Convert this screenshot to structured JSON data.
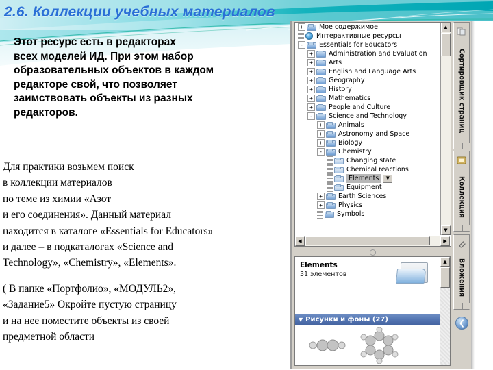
{
  "slide": {
    "title": "2.6. Коллекции учебных материалов",
    "accent_color": "#2a6fd6",
    "header_color": "#00b0b9",
    "paragraph_1": [
      "Этот ресурс есть в редакторах",
      "всех моделей ИД. При этом набор",
      "образовательных объектов в каждом",
      "редакторе свой, что позволяет",
      "заимствовать объекты из разных",
      "редакторов."
    ],
    "paragraph_2": [
      "Для практики возьмем поиск",
      "в коллекции материалов",
      "по теме из химии  «Азот",
      "и его соединения». Данный материал",
      "находится  в каталоге «Essentials for Educators»",
      "и далее – в подкаталогах «Science and",
      "Technology», «Chemistry», «Elements»."
    ],
    "paragraph_3": [
      "( В папке «Портфолио», «МОДУЛЬ2»,",
      "«Задание5» Окройте пустую страницу",
      "и на нее поместите объекты из своей",
      "предметной области"
    ]
  },
  "app": {
    "tree": {
      "items": [
        {
          "label": "Мое содержимое",
          "indent": 0,
          "toggle": "+",
          "icon": "folder-icon"
        },
        {
          "label": "Интерактивные ресурсы",
          "indent": 0,
          "toggle": "none",
          "icon": "globe-icon"
        },
        {
          "label": "Essentials for Educators",
          "indent": 0,
          "toggle": "-",
          "icon": "folder-icon"
        },
        {
          "label": "Administration and Evaluation",
          "indent": 1,
          "toggle": "+",
          "icon": "folder-icon"
        },
        {
          "label": "Arts",
          "indent": 1,
          "toggle": "+",
          "icon": "folder-icon"
        },
        {
          "label": "English and Language Arts",
          "indent": 1,
          "toggle": "+",
          "icon": "folder-icon"
        },
        {
          "label": "Geography",
          "indent": 1,
          "toggle": "+",
          "icon": "folder-icon"
        },
        {
          "label": "History",
          "indent": 1,
          "toggle": "+",
          "icon": "folder-icon"
        },
        {
          "label": "Mathematics",
          "indent": 1,
          "toggle": "+",
          "icon": "folder-icon"
        },
        {
          "label": "People and Culture",
          "indent": 1,
          "toggle": "+",
          "icon": "folder-icon"
        },
        {
          "label": "Science and Technology",
          "indent": 1,
          "toggle": "-",
          "icon": "folder-icon"
        },
        {
          "label": "Animals",
          "indent": 2,
          "toggle": "+",
          "icon": "folder-icon"
        },
        {
          "label": "Astronomy and Space",
          "indent": 2,
          "toggle": "+",
          "icon": "folder-icon"
        },
        {
          "label": "Biology",
          "indent": 2,
          "toggle": "+",
          "icon": "folder-icon"
        },
        {
          "label": "Chemistry",
          "indent": 2,
          "toggle": "-",
          "icon": "folder-icon"
        },
        {
          "label": "Changing state",
          "indent": 3,
          "toggle": "none",
          "icon": "folder-icon"
        },
        {
          "label": "Chemical reactions",
          "indent": 3,
          "toggle": "none",
          "icon": "folder-icon"
        },
        {
          "label": "Elements",
          "indent": 3,
          "toggle": "none",
          "icon": "folder-icon",
          "selected": true,
          "dropdown": "▼"
        },
        {
          "label": "Equipment",
          "indent": 3,
          "toggle": "none",
          "icon": "folder-icon"
        },
        {
          "label": "Earth Sciences",
          "indent": 2,
          "toggle": "+",
          "icon": "folder-icon"
        },
        {
          "label": "Physics",
          "indent": 2,
          "toggle": "+",
          "icon": "folder-icon"
        },
        {
          "label": "Symbols",
          "indent": 2,
          "toggle": "none",
          "icon": "folder-icon"
        }
      ],
      "scroll_up": "▲",
      "scroll_down": "▼",
      "scroll_left": "◀",
      "scroll_right": "▶"
    },
    "gallery": {
      "title": "Elements",
      "subtitle": "31 элементов",
      "section_label": "Рисунки и фоны (27)",
      "section_caret": "▼",
      "scroll_up": "▲"
    },
    "tabs": [
      {
        "label": "Сортировщик страниц",
        "icon": "page-sorter-icon"
      },
      {
        "label": "Коллекция",
        "icon": "gallery-icon"
      },
      {
        "label": "Вложения",
        "icon": "paperclip-icon"
      }
    ],
    "back_button": "❮"
  }
}
